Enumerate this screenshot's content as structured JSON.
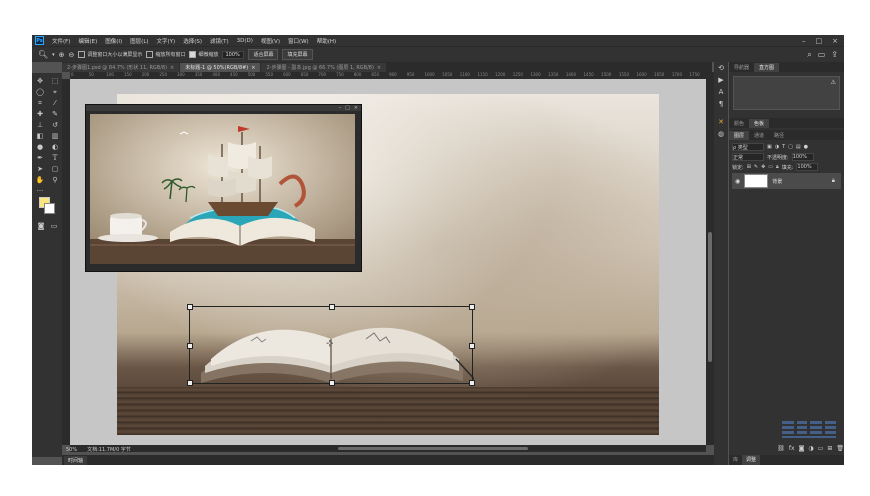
{
  "menubar": {
    "logo": "Ps",
    "items": [
      "文件(F)",
      "编辑(E)",
      "图像(I)",
      "图层(L)",
      "文字(Y)",
      "选择(S)",
      "滤镜(T)",
      "3D(D)",
      "视图(V)",
      "窗口(W)",
      "帮助(H)"
    ],
    "win_min": "–",
    "win_max": "□",
    "win_close": "×"
  },
  "options": {
    "check1": "调整窗口大小以满屏显示",
    "check2": "缩放所有窗口",
    "check3": "细微缩放",
    "zoom_value": "100%",
    "btn_fit": "适合屏幕",
    "btn_fill": "填充屏幕"
  },
  "tabs": [
    {
      "label": "2-步骤图1.psd @ 84.7% (形状 11, RGB/8)",
      "close": "×"
    },
    {
      "label": "未标题-1 @ 50%(RGB/8#)",
      "close": "×"
    },
    {
      "label": "2-步骤图 - 副本.jpg @ 66.7% (图层 1, RGB/8)",
      "close": "×"
    }
  ],
  "rulers": {
    "top": [
      "0",
      "50",
      "100",
      "150",
      "200",
      "250",
      "300",
      "350",
      "400",
      "450",
      "500",
      "550",
      "600",
      "650",
      "700",
      "750",
      "800",
      "850",
      "900",
      "950",
      "1000",
      "1050",
      "1100",
      "1150",
      "1200",
      "1250",
      "1300",
      "1350",
      "1400",
      "1450",
      "1500",
      "1550",
      "1600",
      "1650",
      "1700",
      "1750"
    ]
  },
  "status": {
    "zoom": "50%",
    "doc_info": "文档:11.7M/0 字节"
  },
  "timeline_label": "时间轴",
  "panels": {
    "top_tabs": [
      "导航器",
      "直方图"
    ],
    "mid_tabs": [
      "颜色",
      "色板"
    ],
    "layer_tabs": [
      "图层",
      "通道",
      "路径"
    ],
    "kind_label": "ρ 类型",
    "blend_mode": "正常",
    "opacity_label": "不透明度:",
    "opacity_value": "100%",
    "lock_label": "锁定:",
    "fill_label": "填充:",
    "fill_value": "100%",
    "layer_name": "背景",
    "bottom_tabs": [
      "库",
      "调整"
    ]
  },
  "colors": {
    "foreground": "#fbe67c",
    "background": "#ffffff",
    "accent": "#31a8ff"
  }
}
